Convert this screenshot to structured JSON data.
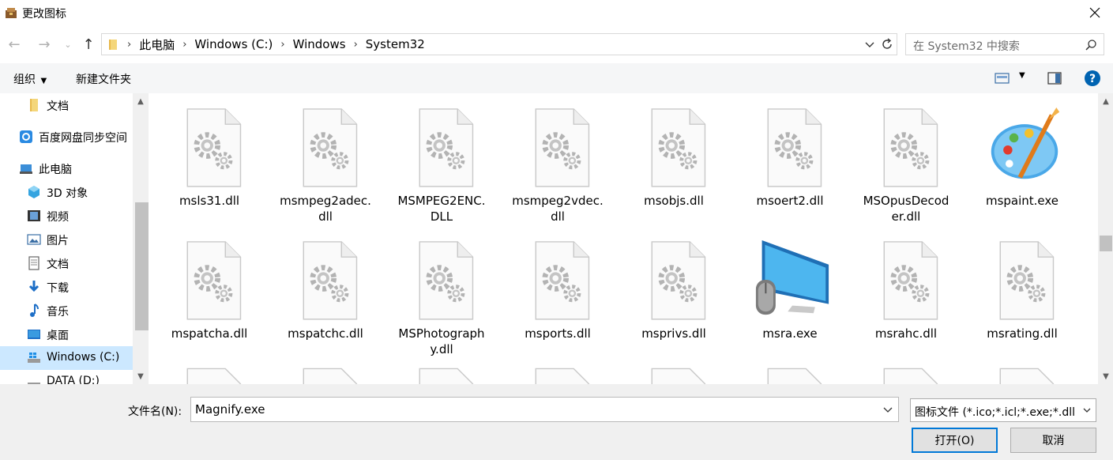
{
  "window": {
    "title": "更改图标"
  },
  "address": {
    "crumbs": [
      "此电脑",
      "Windows (C:)",
      "Windows",
      "System32"
    ],
    "search_placeholder": "在 System32 中搜索"
  },
  "toolbar": {
    "organize": "组织",
    "new_folder": "新建文件夹"
  },
  "sidebar": {
    "items": [
      {
        "label": "文档",
        "icon": "folder-icon"
      },
      {
        "label": "百度网盘同步空间",
        "icon": "baidu-netdisk-icon"
      },
      {
        "label": "此电脑",
        "icon": "computer-icon"
      },
      {
        "label": "3D 对象",
        "icon": "3d-objects-icon"
      },
      {
        "label": "视频",
        "icon": "video-icon"
      },
      {
        "label": "图片",
        "icon": "pictures-icon"
      },
      {
        "label": "文档",
        "icon": "documents-icon"
      },
      {
        "label": "下载",
        "icon": "download-icon"
      },
      {
        "label": "音乐",
        "icon": "music-icon"
      },
      {
        "label": "桌面",
        "icon": "desktop-icon"
      },
      {
        "label": "Windows (C:)",
        "icon": "drive-icon",
        "selected": true
      },
      {
        "label": "DATA (D:)",
        "icon": "drive-icon"
      }
    ]
  },
  "files": [
    {
      "name": "msls31.dll",
      "icon": "dll-gear-icon"
    },
    {
      "name": "msmpeg2adec.\ndll",
      "icon": "dll-gear-icon"
    },
    {
      "name": "MSMPEG2ENC.\nDLL",
      "icon": "dll-gear-icon"
    },
    {
      "name": "msmpeg2vdec.\ndll",
      "icon": "dll-gear-icon"
    },
    {
      "name": "msobjs.dll",
      "icon": "dll-gear-icon"
    },
    {
      "name": "msoert2.dll",
      "icon": "dll-gear-icon"
    },
    {
      "name": "MSOpusDecod\ner.dll",
      "icon": "dll-gear-icon"
    },
    {
      "name": "mspaint.exe",
      "icon": "paint-palette-icon"
    },
    {
      "name": "mspatcha.dll",
      "icon": "dll-gear-icon"
    },
    {
      "name": "mspatchc.dll",
      "icon": "dll-gear-icon"
    },
    {
      "name": "MSPhotograph\ny.dll",
      "icon": "dll-gear-icon"
    },
    {
      "name": "msports.dll",
      "icon": "dll-gear-icon"
    },
    {
      "name": "msprivs.dll",
      "icon": "dll-gear-icon"
    },
    {
      "name": "msra.exe",
      "icon": "remote-assistance-monitor-icon"
    },
    {
      "name": "msrahc.dll",
      "icon": "dll-gear-icon"
    },
    {
      "name": "msrating.dll",
      "icon": "dll-gear-icon"
    }
  ],
  "bottom": {
    "filename_label": "文件名(N):",
    "filename_value": "Magnify.exe",
    "filetype_value": "图标文件 (*.ico;*.icl;*.exe;*.dll",
    "open_label": "打开(O)",
    "cancel_label": "取消"
  }
}
